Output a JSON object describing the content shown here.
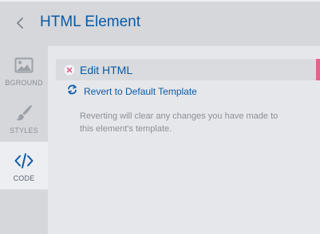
{
  "header": {
    "title": "HTML Element",
    "back_icon": "chevron-left-icon"
  },
  "sidebar": {
    "items": [
      {
        "label": "BGROUND",
        "icon": "image-icon",
        "active": false
      },
      {
        "label": "STYLES",
        "icon": "paintbrush-icon",
        "active": false
      },
      {
        "label": "CODE",
        "icon": "code-icon",
        "active": true
      }
    ]
  },
  "main": {
    "edit_html": {
      "label": "Edit HTML",
      "icon": "close-circle-icon",
      "accent_color": "#e2648a"
    },
    "revert": {
      "label": "Revert to Default Template",
      "icon": "refresh-icon"
    },
    "description": "Reverting will clear any changes you have made to this element's template."
  },
  "colors": {
    "accent_blue": "#0b5aa6",
    "accent_pink": "#e2648a",
    "muted_text": "#8b9098"
  }
}
